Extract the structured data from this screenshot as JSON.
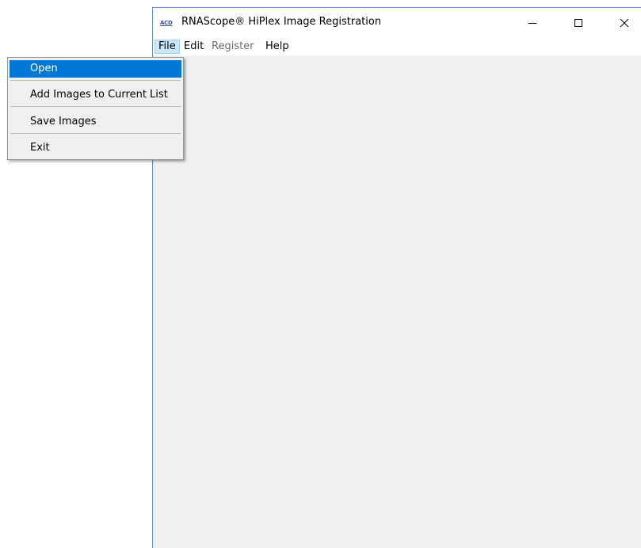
{
  "window": {
    "title": "RNAScope® HiPlex Image Registration",
    "icon_label": "ACD",
    "controls": {
      "minimize": "—",
      "maximize": "☐",
      "close": "✕"
    }
  },
  "menubar": {
    "items": [
      {
        "label": "File",
        "state": "active"
      },
      {
        "label": "Edit",
        "state": "normal"
      },
      {
        "label": "Register",
        "state": "disabled"
      },
      {
        "label": "Help",
        "state": "normal"
      }
    ]
  },
  "file_menu": {
    "items": [
      {
        "label": "Open",
        "highlighted": true
      },
      {
        "label": "Add Images to Current List",
        "highlighted": false
      },
      {
        "label": "Save Images",
        "highlighted": false
      },
      {
        "label": "Exit",
        "highlighted": false
      }
    ]
  },
  "colors": {
    "highlight": "#0078d7",
    "window_border": "#5b8ed6",
    "client_bg": "#f0f0f0",
    "menu_active_bg": "#cce8ff"
  }
}
